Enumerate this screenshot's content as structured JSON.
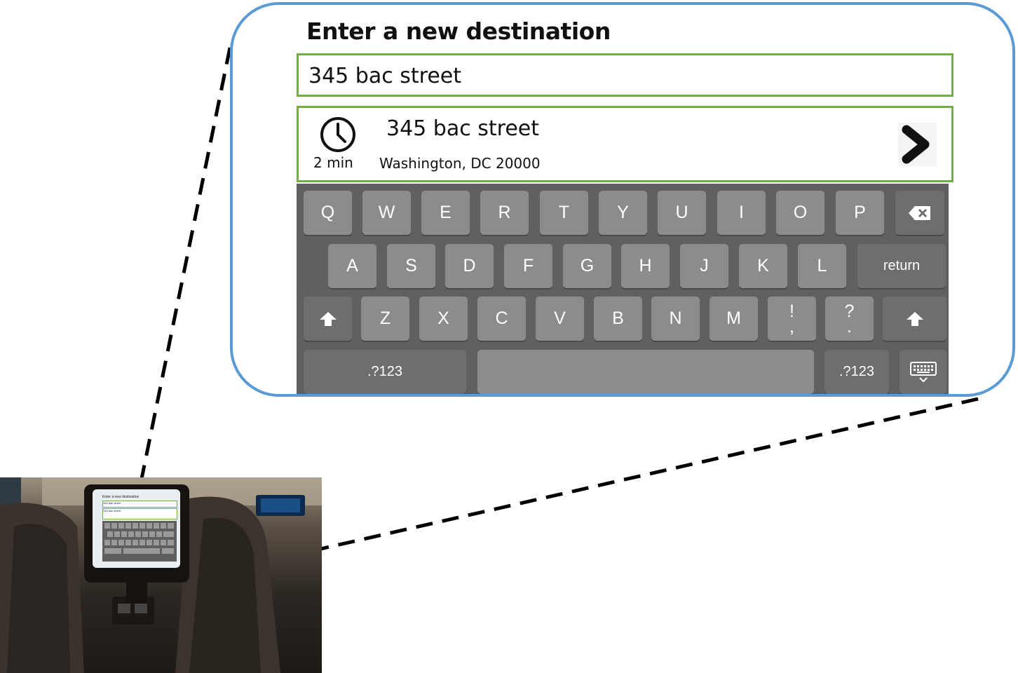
{
  "form": {
    "title": "Enter a new destination",
    "input_value": "345 bac street"
  },
  "suggestion": {
    "eta": "2 min",
    "name": "345 bac street",
    "address": "Washington, DC 20000"
  },
  "keyboard": {
    "row1": [
      "Q",
      "W",
      "E",
      "R",
      "T",
      "Y",
      "U",
      "I",
      "O",
      "P"
    ],
    "row2": [
      "A",
      "S",
      "D",
      "F",
      "G",
      "H",
      "J",
      "K",
      "L"
    ],
    "return_label": "return",
    "row3": [
      "Z",
      "X",
      "C",
      "V",
      "B",
      "N",
      "M"
    ],
    "punct1_top": "!",
    "punct1_bottom": ",",
    "punct2_top": "?",
    "punct2_bottom": ".",
    "symbols_left": ".?123",
    "symbols_right": ".?123"
  },
  "icons": {
    "clock": "clock-icon",
    "go": "chevron-right-icon",
    "backspace": "backspace-icon",
    "shift": "shift-icon",
    "hide_keyboard": "keyboard-hide-icon"
  },
  "colors": {
    "callout_border": "#5b9bd5",
    "field_border": "#70ad47",
    "keyboard_bg": "#606060",
    "key_bg": "#8c8c8c"
  }
}
